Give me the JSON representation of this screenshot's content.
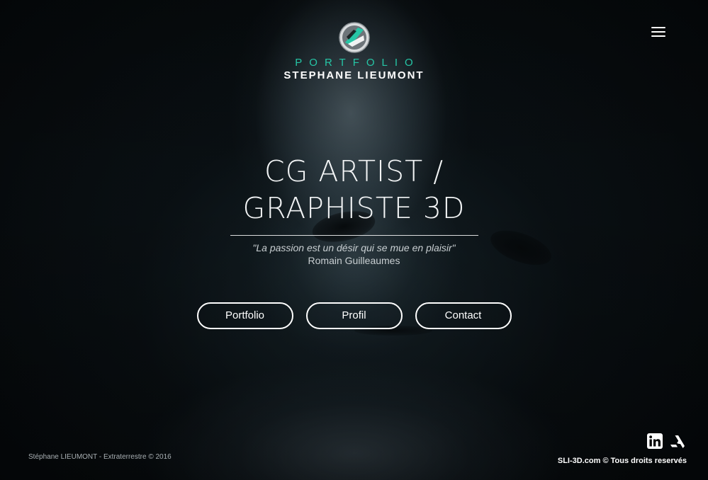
{
  "logo": {
    "portfolio_text": "PORTFOLIO",
    "name_text": "STEPHANE LIEUMONT",
    "icon": "sli-logo-mark",
    "accent_color": "#26c6a6"
  },
  "header": {
    "menu_icon": "hamburger-menu-icon"
  },
  "hero": {
    "title_line1": "CG ARTIST /",
    "title_line2": "GRAPHISTE 3D",
    "quote": "\"La passion est un désir qui se mue en plaisir\"",
    "quote_author": "Romain Guilleaumes"
  },
  "nav": {
    "buttons": [
      {
        "label": "Portfolio"
      },
      {
        "label": "Profil"
      },
      {
        "label": "Contact"
      }
    ]
  },
  "footer": {
    "credit": "Stéphane LIEUMONT - Extraterrestre © 2016",
    "copyright": "SLI-3D.com © Tous droits reservés",
    "social": [
      {
        "name": "linkedin-icon"
      },
      {
        "name": "artstation-icon"
      }
    ]
  }
}
